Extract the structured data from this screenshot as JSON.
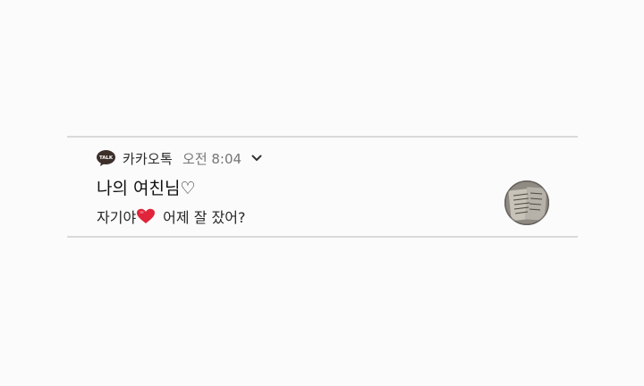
{
  "notification": {
    "app_name": "카카오톡",
    "time": "오전 8:04",
    "app_icon": "kakaotalk-speech-bubble-icon",
    "app_icon_text": "TALK",
    "expand_icon": "chevron-down-icon",
    "title": "나의 여친님♡",
    "message_before": "자기야",
    "message_emoji": "red-heart-emoji",
    "message_after": "어제 잘 잤어?",
    "avatar": "profile-photo-thumbnail"
  },
  "colors": {
    "background": "#fbfbfb",
    "divider": "#d9d9d9",
    "title": "#111111",
    "secondary_text": "#767676",
    "heart": "#e0243a"
  }
}
